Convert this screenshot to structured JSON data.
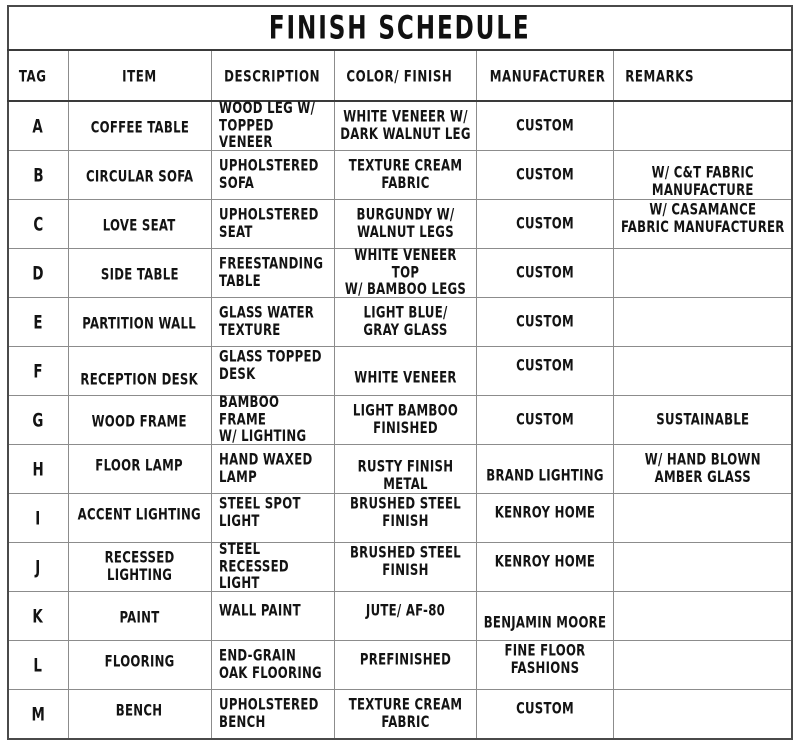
{
  "document": {
    "title": "FINISH SCHEDULE"
  },
  "table": {
    "columns": [
      {
        "key": "tag",
        "label": "TAG"
      },
      {
        "key": "item",
        "label": "ITEM"
      },
      {
        "key": "description",
        "label": "DESCRIPTION"
      },
      {
        "key": "color_finish",
        "label": "COLOR/ FINISH"
      },
      {
        "key": "manufacturer",
        "label": "MANUFACTURER"
      },
      {
        "key": "remarks",
        "label": "REMARKS"
      }
    ],
    "rows": [
      {
        "tag": "A",
        "item": "COFFEE TABLE",
        "description": "WOOD LEG W/\nTOPPED VENEER",
        "color_finish": "WHITE VENEER W/\nDARK WALNUT LEG",
        "manufacturer": "CUSTOM",
        "remarks": ""
      },
      {
        "tag": "B",
        "item": "CIRCULAR SOFA",
        "description": "UPHOLSTERED\nSOFA",
        "color_finish": "TEXTURE CREAM\nFABRIC",
        "manufacturer": "CUSTOM",
        "remarks": "W/ C&T FABRIC\nMANUFACTURE"
      },
      {
        "tag": "C",
        "item": "LOVE SEAT",
        "description": "UPHOLSTERED\nSEAT",
        "color_finish": "BURGUNDY W/\nWALNUT LEGS",
        "manufacturer": "CUSTOM",
        "remarks": "W/ CASAMANCE\nFABRIC MANUFACTURER"
      },
      {
        "tag": "D",
        "item": "SIDE TABLE",
        "description": "FREESTANDING\nTABLE",
        "color_finish": "WHITE VENEER TOP\nW/ BAMBOO LEGS",
        "manufacturer": "CUSTOM",
        "remarks": ""
      },
      {
        "tag": "E",
        "item": "PARTITION WALL",
        "description": "GLASS WATER\nTEXTURE",
        "color_finish": "LIGHT BLUE/\nGRAY GLASS",
        "manufacturer": "CUSTOM",
        "remarks": ""
      },
      {
        "tag": "F",
        "item": "RECEPTION DESK",
        "description": "GLASS TOPPED\nDESK",
        "color_finish": "WHITE VENEER",
        "manufacturer": "CUSTOM",
        "remarks": ""
      },
      {
        "tag": "G",
        "item": "WOOD FRAME",
        "description": "BAMBOO FRAME\nW/ LIGHTING",
        "color_finish": "LIGHT BAMBOO\nFINISHED",
        "manufacturer": "CUSTOM",
        "remarks": "SUSTAINABLE"
      },
      {
        "tag": "H",
        "item": "FLOOR LAMP",
        "description": "HAND WAXED\nLAMP",
        "color_finish": "RUSTY FINISH\nMETAL",
        "manufacturer": "BRAND LIGHTING",
        "remarks": "W/ HAND BLOWN\nAMBER GLASS"
      },
      {
        "tag": "I",
        "item": "ACCENT LIGHTING",
        "description": "STEEL SPOT\nLIGHT",
        "color_finish": "BRUSHED STEEL\nFINISH",
        "manufacturer": "KENROY HOME",
        "remarks": ""
      },
      {
        "tag": "J",
        "item": "RECESSED\nLIGHTING",
        "description": "STEEL\nRECESSED LIGHT",
        "color_finish": "BRUSHED STEEL\nFINISH",
        "manufacturer": "KENROY HOME",
        "remarks": ""
      },
      {
        "tag": "K",
        "item": "PAINT",
        "description": "WALL PAINT",
        "color_finish": "JUTE/ AF-80",
        "manufacturer": "BENJAMIN MOORE",
        "remarks": ""
      },
      {
        "tag": "L",
        "item": "FLOORING",
        "description": "END-GRAIN\nOAK FLOORING",
        "color_finish": "PREFINISHED",
        "manufacturer": "FINE FLOOR\nFASHIONS",
        "remarks": ""
      },
      {
        "tag": "M",
        "item": "BENCH",
        "description": "UPHOLSTERED\nBENCH",
        "color_finish": "TEXTURE CREAM\nFABRIC",
        "manufacturer": "CUSTOM",
        "remarks": ""
      }
    ]
  },
  "style": {
    "ink_color": "#131313",
    "rule_color": "#8c8c8c",
    "frame_color": "#3a3a3a",
    "paper_color": "#ffffff"
  }
}
